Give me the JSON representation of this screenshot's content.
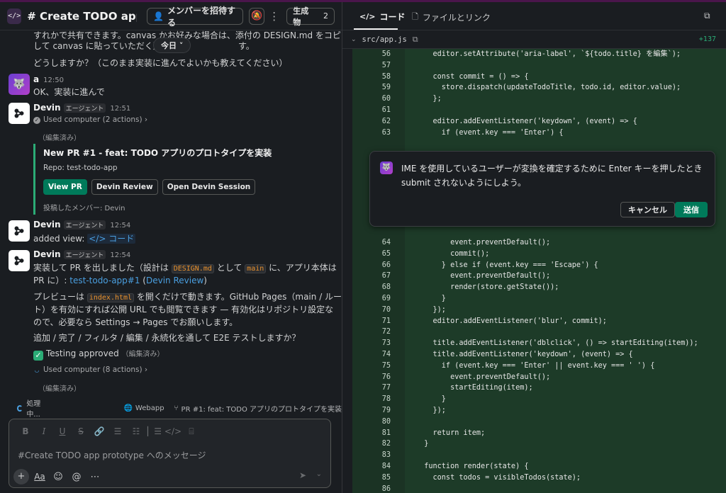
{
  "header": {
    "app_icon": "</>",
    "channel_title": "# Create TODO app p...",
    "invite_label": "メンバーを招待する",
    "artifacts_label": "生成物",
    "artifacts_count": "2"
  },
  "messages": {
    "prev_line1": "すれかで共有できます。canvas かお好みな場合は、添付の DESIGN.md をコピー",
    "prev_line2": "して canvas に貼っていただく形",
    "prev_line2b": "す。",
    "today_pill": "今日 ˅",
    "prev_line3": "どうしますか？（このまま実装に進んでよいかも教えてください）",
    "m1": {
      "name": "a",
      "time": "12:50",
      "text": "OK、実装に進んで"
    },
    "m2": {
      "name": "Devin",
      "tag": "エージェント",
      "time": "12:51",
      "used": "Used computer (2 actions) ›",
      "edited": "（編集済み）",
      "pr_title": "New PR  #1 - feat: TODO アプリのプロトタイプを実装",
      "pr_repo": "Repo: test-todo-app",
      "btn_view": "View PR",
      "btn_review": "Devin Review",
      "btn_session": "Open Devin Session",
      "posted_by": "投稿したメンバー: Devin"
    },
    "m3": {
      "name": "Devin",
      "tag": "エージェント",
      "time": "12:54",
      "text": "added view:",
      "view": "</> コード"
    },
    "m4": {
      "name": "Devin",
      "tag": "エージェント",
      "time": "12:54",
      "l1a": "実装して PR を出しました（設計は",
      "l1_code1": "DESIGN.md",
      "l1b": "として",
      "l1_code2": "main",
      "l1c": "に、アプリ本体は",
      "l2a": "PR に）:",
      "l2_link1": "test-todo-app#1",
      "l2_paren_open": " (",
      "l2_link2": "Devin Review",
      "l2_paren_close": ")",
      "l3a": "プレビューは",
      "l3_code": "index.html",
      "l3b": "を開くだけで動きます。GitHub Pages（main / ルー",
      "l4": "ト）を有効にすれば公開 URL でも閲覧できます — 有効化はリポジトリ設定な",
      "l5": "ので、必要なら Settings → Pages でお願いします。",
      "l6": "追加 / 完了 / フィルタ / 編集 / 永続化を通して E2E テストしますか？",
      "approved": "Testing approved",
      "approved_edited": "（編集済み）",
      "used": "Used computer (8 actions) ›",
      "edited": "（編集済み）"
    }
  },
  "status": {
    "processing": "処理中...",
    "webapp": "Webapp",
    "pr": "PR #1: feat: TODO アプリのプロトタイプを実装"
  },
  "composer": {
    "placeholder": "#Create TODO app prototype へのメッセージ"
  },
  "right": {
    "tab_code": "コード",
    "tab_files": "ファイルとリンク",
    "file_path": "src/app.js",
    "added": "+137",
    "ime_text": "IME を使用しているユーザーが変換を確定するために Enter キーを押したとき submit されないようにしよう。",
    "cancel_label": "キャンセル",
    "submit_label": "送信"
  },
  "code_lines_top": [
    {
      "n": "56",
      "t": "    editor.setAttribute('aria-label', `${todo.title} を編集`);"
    },
    {
      "n": "57",
      "t": ""
    },
    {
      "n": "58",
      "t": "    const commit = () => {"
    },
    {
      "n": "59",
      "t": "      store.dispatch(updateTodoTitle, todo.id, editor.value);"
    },
    {
      "n": "60",
      "t": "    };"
    },
    {
      "n": "61",
      "t": ""
    },
    {
      "n": "62",
      "t": "    editor.addEventListener('keydown', (event) => {"
    },
    {
      "n": "63",
      "t": "      if (event.key === 'Enter') {"
    }
  ],
  "code_lines_bottom": [
    {
      "n": "64",
      "t": "        event.preventDefault();"
    },
    {
      "n": "65",
      "t": "        commit();"
    },
    {
      "n": "66",
      "t": "      } else if (event.key === 'Escape') {"
    },
    {
      "n": "67",
      "t": "        event.preventDefault();"
    },
    {
      "n": "68",
      "t": "        render(store.getState());"
    },
    {
      "n": "69",
      "t": "      }"
    },
    {
      "n": "70",
      "t": "    });"
    },
    {
      "n": "71",
      "t": "    editor.addEventListener('blur', commit);"
    },
    {
      "n": "72",
      "t": ""
    },
    {
      "n": "73",
      "t": "    title.addEventListener('dblclick', () => startEditing(item));"
    },
    {
      "n": "74",
      "t": "    title.addEventListener('keydown', (event) => {"
    },
    {
      "n": "75",
      "t": "      if (event.key === 'Enter' || event.key === ' ') {"
    },
    {
      "n": "76",
      "t": "        event.preventDefault();"
    },
    {
      "n": "77",
      "t": "        startEditing(item);"
    },
    {
      "n": "78",
      "t": "      }"
    },
    {
      "n": "79",
      "t": "    });"
    },
    {
      "n": "80",
      "t": ""
    },
    {
      "n": "81",
      "t": "    return item;"
    },
    {
      "n": "82",
      "t": "  }"
    },
    {
      "n": "83",
      "t": ""
    },
    {
      "n": "84",
      "t": "  function render(state) {"
    },
    {
      "n": "85",
      "t": "    const todos = visibleTodos(state);"
    },
    {
      "n": "86",
      "t": ""
    }
  ]
}
